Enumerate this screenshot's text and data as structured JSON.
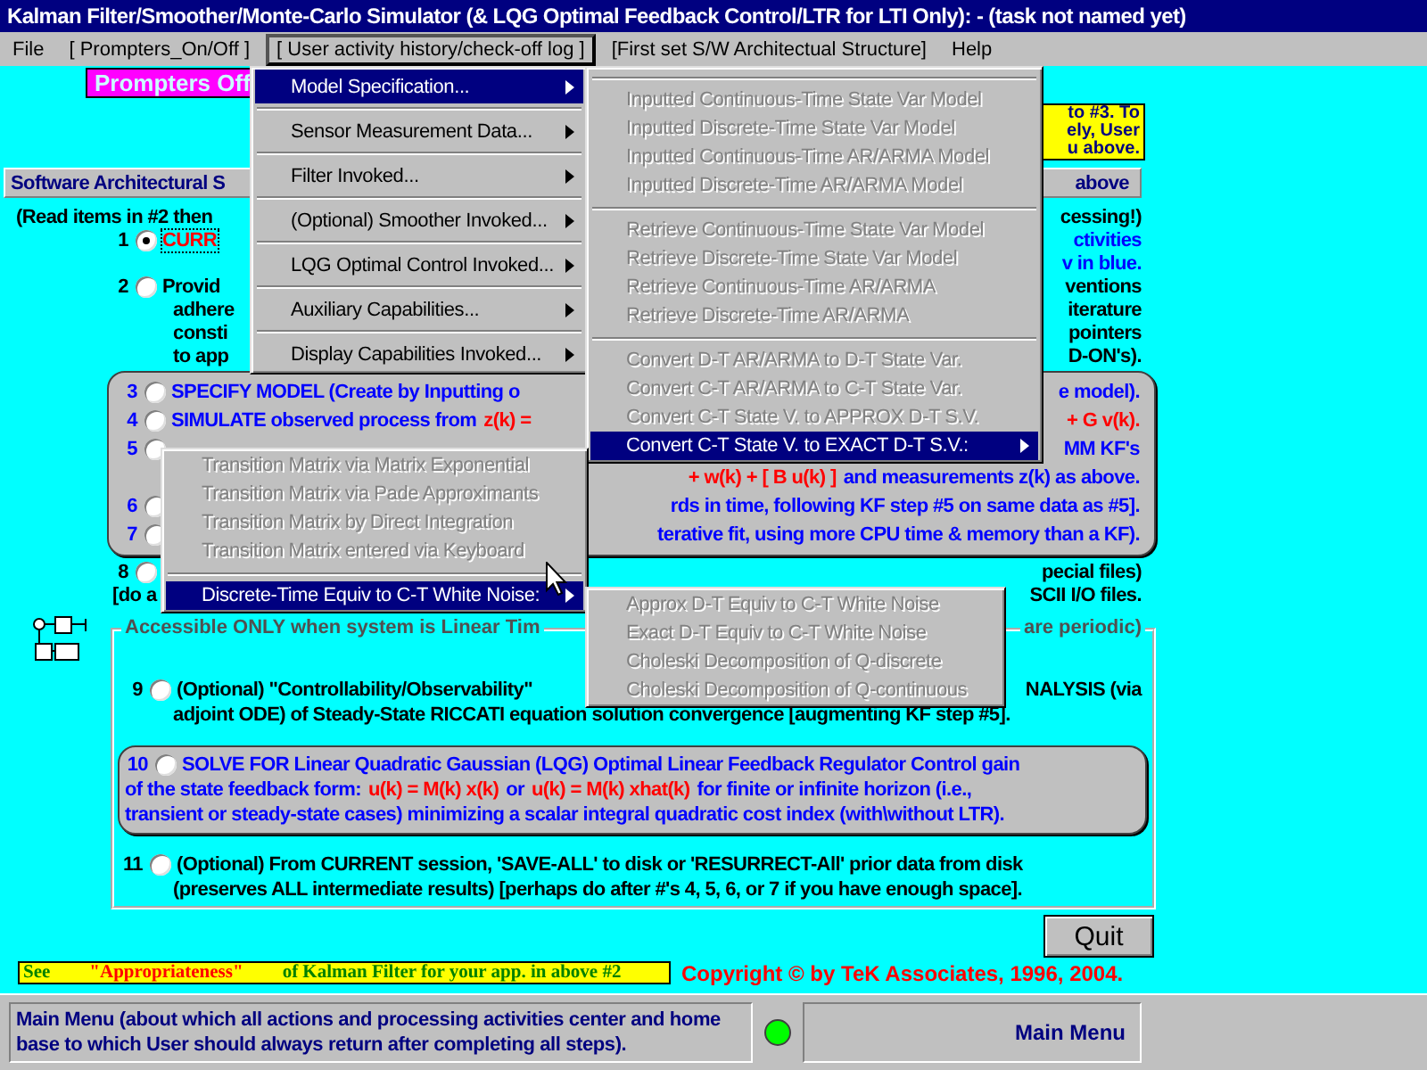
{
  "window": {
    "title": "Kalman Filter/Smoother/Monte-Carlo Simulator (& LQG Optimal Feedback Control/LTR for LTI Only): - (task not named yet)"
  },
  "menu_bar": [
    {
      "label": "File",
      "selected": false
    },
    {
      "label": "[ Prompters_On/Off ]",
      "selected": false
    },
    {
      "label": "[ User activity history/check-off log ]",
      "selected": true
    },
    {
      "label": "[First set S/W Architectual Structure]",
      "selected": false
    },
    {
      "label": "Help",
      "selected": false
    }
  ],
  "menus": [
    {
      "items": [
        {
          "kind": "item",
          "label": "Model Specification...",
          "selected": true,
          "disabled": false,
          "submenu": true
        },
        {
          "kind": "separator"
        },
        {
          "kind": "item",
          "label": "Sensor Measurement Data...",
          "selected": false,
          "disabled": false,
          "submenu": true
        },
        {
          "kind": "separator"
        },
        {
          "kind": "item",
          "label": "Filter Invoked...",
          "selected": false,
          "disabled": false,
          "submenu": true
        },
        {
          "kind": "separator"
        },
        {
          "kind": "item",
          "label": "(Optional) Smoother Invoked...",
          "selected": false,
          "disabled": false,
          "submenu": true
        },
        {
          "kind": "separator"
        },
        {
          "kind": "item",
          "label": "LQG Optimal Control Invoked...",
          "selected": false,
          "disabled": false,
          "submenu": true
        },
        {
          "kind": "separator"
        },
        {
          "kind": "item",
          "label": "Auxiliary Capabilities...",
          "selected": false,
          "disabled": false,
          "submenu": true
        },
        {
          "kind": "separator"
        },
        {
          "kind": "item",
          "label": "Display Capabilities Invoked...",
          "selected": false,
          "disabled": false,
          "submenu": true
        }
      ]
    },
    {
      "items": [
        {
          "kind": "separator"
        },
        {
          "kind": "item",
          "label": "Inputted Continuous-Time State Var Model",
          "selected": false,
          "disabled": true,
          "submenu": false
        },
        {
          "kind": "item",
          "label": "Inputted Discrete-Time State Var Model",
          "selected": false,
          "disabled": true,
          "submenu": false
        },
        {
          "kind": "item",
          "label": "Inputted Continuous-Time AR/ARMA Model",
          "selected": false,
          "disabled": true,
          "submenu": false
        },
        {
          "kind": "item",
          "label": "Inputted Discrete-Time AR/ARMA Model",
          "selected": false,
          "disabled": true,
          "submenu": false
        },
        {
          "kind": "separator"
        },
        {
          "kind": "item",
          "label": "Retrieve Continuous-Time State Var Model",
          "selected": false,
          "disabled": true,
          "submenu": false
        },
        {
          "kind": "item",
          "label": "Retrieve Discrete-Time State Var Model",
          "selected": false,
          "disabled": true,
          "submenu": false
        },
        {
          "kind": "item",
          "label": "Retrieve Continuous-Time AR/ARMA",
          "selected": false,
          "disabled": true,
          "submenu": false
        },
        {
          "kind": "item",
          "label": "Retrieve Discrete-Time AR/ARMA",
          "selected": false,
          "disabled": true,
          "submenu": false
        },
        {
          "kind": "separator"
        },
        {
          "kind": "item",
          "label": "Convert D-T AR/ARMA to D-T State Var.",
          "selected": false,
          "disabled": true,
          "submenu": false
        },
        {
          "kind": "item",
          "label": "Convert C-T AR/ARMA to C-T State Var.",
          "selected": false,
          "disabled": true,
          "submenu": false
        },
        {
          "kind": "item",
          "label": "Convert C-T State V. to APPROX D-T S.V.",
          "selected": false,
          "disabled": true,
          "submenu": false
        },
        {
          "kind": "item",
          "label": "Convert C-T State V. to EXACT D-T S.V.:",
          "selected": true,
          "disabled": false,
          "submenu": true
        }
      ]
    },
    {
      "items": [
        {
          "kind": "item",
          "label": "Transition Matrix via Matrix Exponential",
          "selected": false,
          "disabled": true,
          "submenu": false
        },
        {
          "kind": "item",
          "label": "Transition Matrix via Pade Approximants",
          "selected": false,
          "disabled": true,
          "submenu": false
        },
        {
          "kind": "item",
          "label": "Transition Matrix by Direct Integration",
          "selected": false,
          "disabled": true,
          "submenu": false
        },
        {
          "kind": "item",
          "label": "Transition Matrix entered via Keyboard",
          "selected": false,
          "disabled": true,
          "submenu": false
        },
        {
          "kind": "separator"
        },
        {
          "kind": "item",
          "label": "Discrete-Time Equiv to C-T White Noise:",
          "selected": true,
          "disabled": false,
          "submenu": true
        }
      ]
    },
    {
      "items": [
        {
          "kind": "item",
          "label": "Approx D-T Equiv to C-T White Noise",
          "selected": false,
          "disabled": true,
          "submenu": false
        },
        {
          "kind": "item",
          "label": "Exact D-T Equiv to C-T White Noise",
          "selected": false,
          "disabled": true,
          "submenu": false
        },
        {
          "kind": "item",
          "label": "Choleski Decomposition of Q-discrete",
          "selected": false,
          "disabled": true,
          "submenu": false
        },
        {
          "kind": "item",
          "label": "Choleski Decomposition of Q-continuous",
          "selected": false,
          "disabled": true,
          "submenu": false
        }
      ]
    }
  ],
  "prompters_label": "Prompters Off",
  "hint_note": [
    "to #3. To",
    "ely, User",
    "u above."
  ],
  "architecture_bar": {
    "left": "Software Architectural S",
    "right": "above"
  },
  "sections": [
    {
      "kind": "plain",
      "lines": [
        {
          "kind": "full",
          "left": [
            {
              "text": "(Read items in #2 then",
              "color": "#000000"
            }
          ],
          "right": [
            {
              "text": "cessing!)",
              "color": "#000000"
            }
          ]
        },
        {
          "kind": "numbered",
          "number": "1",
          "radio": {
            "checked": true
          },
          "left": [
            {
              "text": "CURR",
              "color": "#ff0000",
              "focused": true
            }
          ],
          "right": [
            {
              "text": "ctivities",
              "color": "#0000ff"
            }
          ]
        },
        {
          "kind": "continuation",
          "right": [
            {
              "text": "v in blue.",
              "color": "#0000ff"
            }
          ]
        },
        {
          "kind": "numbered",
          "number": "2",
          "radio": {
            "checked": false
          },
          "left": [
            {
              "text": "Provid",
              "color": "#000000"
            }
          ],
          "right": [
            {
              "text": "ventions",
              "color": "#000000"
            }
          ]
        },
        {
          "kind": "continuation",
          "left": [
            {
              "text": "adhere",
              "color": "#000000"
            }
          ],
          "right": [
            {
              "text": "iterature",
              "color": "#000000"
            }
          ]
        },
        {
          "kind": "continuation",
          "left": [
            {
              "text": "consti",
              "color": "#000000"
            }
          ],
          "right": [
            {
              "text": "pointers",
              "color": "#000000"
            }
          ]
        },
        {
          "kind": "continuation",
          "left": [
            {
              "text": "to app",
              "color": "#000000"
            }
          ],
          "right": [
            {
              "text": "D-ON's).",
              "color": "#000000"
            }
          ]
        }
      ]
    },
    {
      "kind": "panel",
      "lines": [
        {
          "kind": "numbered",
          "number": "3",
          "radio": {
            "checked": false
          },
          "left": [
            {
              "text": "SPECIFY MODEL  (Create by Inputting o",
              "color": "#0000ff"
            }
          ],
          "right": [
            {
              "text": "e model).",
              "color": "#0000ff"
            }
          ]
        },
        {
          "kind": "numbered",
          "number": "4",
          "radio": {
            "checked": false
          },
          "left": [
            {
              "text": "SIMULATE observed process from",
              "color": "#0000ff"
            },
            {
              "text": "z(k) =",
              "color": "#ff0000"
            }
          ],
          "right": [
            {
              "text": "+ G v(k).",
              "color": "#ff0000"
            }
          ]
        },
        {
          "kind": "numbered",
          "number": "5",
          "radio": {
            "checked": false
          },
          "right": [
            {
              "text": "MM KF's",
              "color": "#0000ff"
            }
          ]
        },
        {
          "kind": "continuation",
          "right": [
            {
              "text": "+ w(k) + [ B u(k) ]",
              "color": "#ff0000"
            },
            {
              "text": "and measurements z(k) as above.",
              "color": "#0000ff"
            }
          ]
        },
        {
          "kind": "numbered",
          "number": "6",
          "radio": {
            "checked": false
          },
          "right": [
            {
              "text": "rds in time, following KF step #5 on same data as #5].",
              "color": "#0000ff"
            }
          ]
        },
        {
          "kind": "numbered",
          "number": "7",
          "radio": {
            "checked": false
          },
          "right": [
            {
              "text": "terative fit, using more CPU time & memory than a KF).",
              "color": "#0000ff"
            }
          ]
        }
      ]
    },
    {
      "kind": "plain",
      "lines": [
        {
          "kind": "numbered",
          "number": "8",
          "radio": {
            "checked": false
          },
          "right": [
            {
              "text": "pecial files)",
              "color": "#000000"
            }
          ]
        },
        {
          "kind": "outdent",
          "left": [
            {
              "text": "[do a",
              "color": "#000000"
            }
          ],
          "right": [
            {
              "text": "SCII I/O files.",
              "color": "#000000"
            }
          ]
        }
      ]
    },
    {
      "kind": "group",
      "label_left": "Accessible ONLY when system is Linear Tim",
      "label_right": "are periodic)",
      "sections": [
        {
          "kind": "plain",
          "lines": [
            {
              "kind": "numbered",
              "number": "9",
              "radio": {
                "checked": false
              },
              "left": [
                {
                  "text": "(Optional) \"Controllability/Observability\"",
                  "color": "#000000"
                }
              ],
              "right": [
                {
                  "text": "NALYSIS (via",
                  "color": "#000000"
                }
              ]
            },
            {
              "kind": "continuation",
              "left": [
                {
                  "text": "adjoint ODE) of Steady-State RICCATI equation solution convergence [augmenting KF step #5].",
                  "color": "#000000"
                }
              ]
            }
          ]
        },
        {
          "kind": "panel",
          "lines": [
            {
              "kind": "numbered",
              "number": "10",
              "radio": {
                "checked": false
              },
              "left": [
                {
                  "text": "SOLVE FOR Linear Quadratic Gaussian (LQG) Optimal Linear Feedback Regulator Control gain",
                  "color": "#0000ff"
                }
              ]
            },
            {
              "kind": "outdent",
              "left": [
                {
                  "text": "of the state feedback form:",
                  "color": "#0000ff"
                },
                {
                  "text": "u(k) = M(k) x(k)",
                  "color": "#ff0000"
                },
                {
                  "text": "or",
                  "color": "#0000ff"
                },
                {
                  "text": "u(k) = M(k) xhat(k)",
                  "color": "#ff0000"
                },
                {
                  "text": "for finite or infinite horizon (i.e.,",
                  "color": "#0000ff"
                }
              ]
            },
            {
              "kind": "outdent",
              "left": [
                {
                  "text": "transient or steady-state cases) minimizing a scalar integral quadratic cost index (with\\without LTR).",
                  "color": "#0000ff"
                }
              ]
            }
          ]
        },
        {
          "kind": "plain",
          "lines": [
            {
              "kind": "numbered",
              "number": "11",
              "radio": {
                "checked": false
              },
              "left": [
                {
                  "text": "(Optional) From CURRENT session, 'SAVE-ALL' to disk or 'RESURRECT-All' prior data from disk",
                  "color": "#000000"
                }
              ]
            },
            {
              "kind": "continuation",
              "left": [
                {
                  "text": "(preserves ALL intermediate results) [perhaps do after #'s 4, 5, 6, or 7 if you have enough space].",
                  "color": "#000000"
                }
              ]
            }
          ]
        }
      ]
    }
  ],
  "quit_button": "Quit",
  "footer_note": [
    {
      "text": "See",
      "kind": "plain"
    },
    {
      "text": "\"Appropriateness\"",
      "kind": "emphasis"
    },
    {
      "text": "of Kalman Filter for your app. in above #2",
      "kind": "plain"
    }
  ],
  "copyright": "Copyright © by TeK Associates, 1996, 2004.",
  "status_bar": {
    "message": "Main Menu (about which all actions and processing activities center and home base to which User should always return after completing all steps).",
    "panel": "Main Menu"
  }
}
